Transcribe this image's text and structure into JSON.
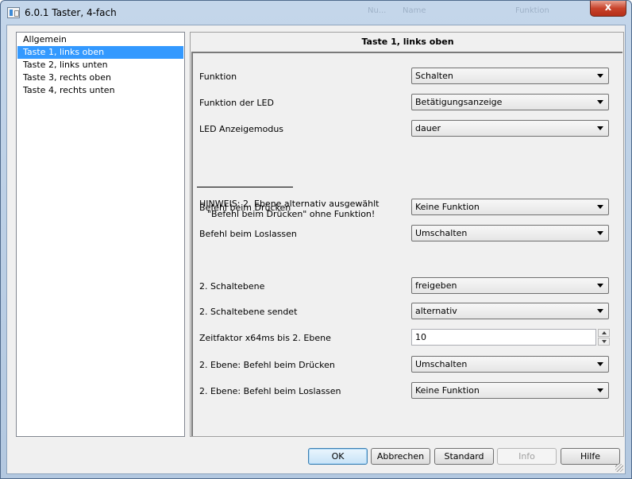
{
  "window": {
    "title": "6.0.1 Taster, 4-fach",
    "close_label": "x",
    "ghost_texts": [
      "Nu...",
      "Name",
      "Funktion"
    ]
  },
  "tree": {
    "items": [
      {
        "label": "Allgemein",
        "selected": false
      },
      {
        "label": "Taste 1, links oben",
        "selected": true
      },
      {
        "label": "Taste 2, links unten",
        "selected": false
      },
      {
        "label": "Taste 3, rechts oben",
        "selected": false
      },
      {
        "label": "Taste 4, rechts unten",
        "selected": false
      }
    ]
  },
  "panel": {
    "title": "Taste 1, links oben",
    "rows": {
      "funktion": {
        "label": "Funktion",
        "value": "Schalten"
      },
      "funktion_led": {
        "label": "Funktion der LED",
        "value": "Betätigungsanzeige"
      },
      "led_modus": {
        "label": "LED Anzeigemodus",
        "value": "dauer"
      },
      "befehl_druecken": {
        "label": "Befehl beim Drücken",
        "value": "Keine Funktion"
      },
      "befehl_loslassen": {
        "label": "Befehl beim Loslassen",
        "value": "Umschalten"
      },
      "schaltebene": {
        "label": "2. Schaltebene",
        "value": "freigeben"
      },
      "schaltebene_sendet": {
        "label": "2. Schaltebene sendet",
        "value": "alternativ"
      },
      "zeitfaktor": {
        "label": "Zeitfaktor x64ms bis 2. Ebene",
        "value": "10"
      },
      "ebene_druecken": {
        "label": "2. Ebene: Befehl beim Drücken",
        "value": "Umschalten"
      },
      "ebene_loslassen": {
        "label": "2. Ebene: Befehl beim Loslassen",
        "value": "Keine Funktion"
      }
    },
    "hint": {
      "line1": "HINWEIS: 2. Ebene alternativ ausgewählt",
      "line2": "\"Befehl beim Drücken\" ohne Funktion!"
    }
  },
  "buttons": {
    "ok": "OK",
    "abbrechen": "Abbrechen",
    "standard": "Standard",
    "info": "Info",
    "hilfe": "Hilfe"
  }
}
